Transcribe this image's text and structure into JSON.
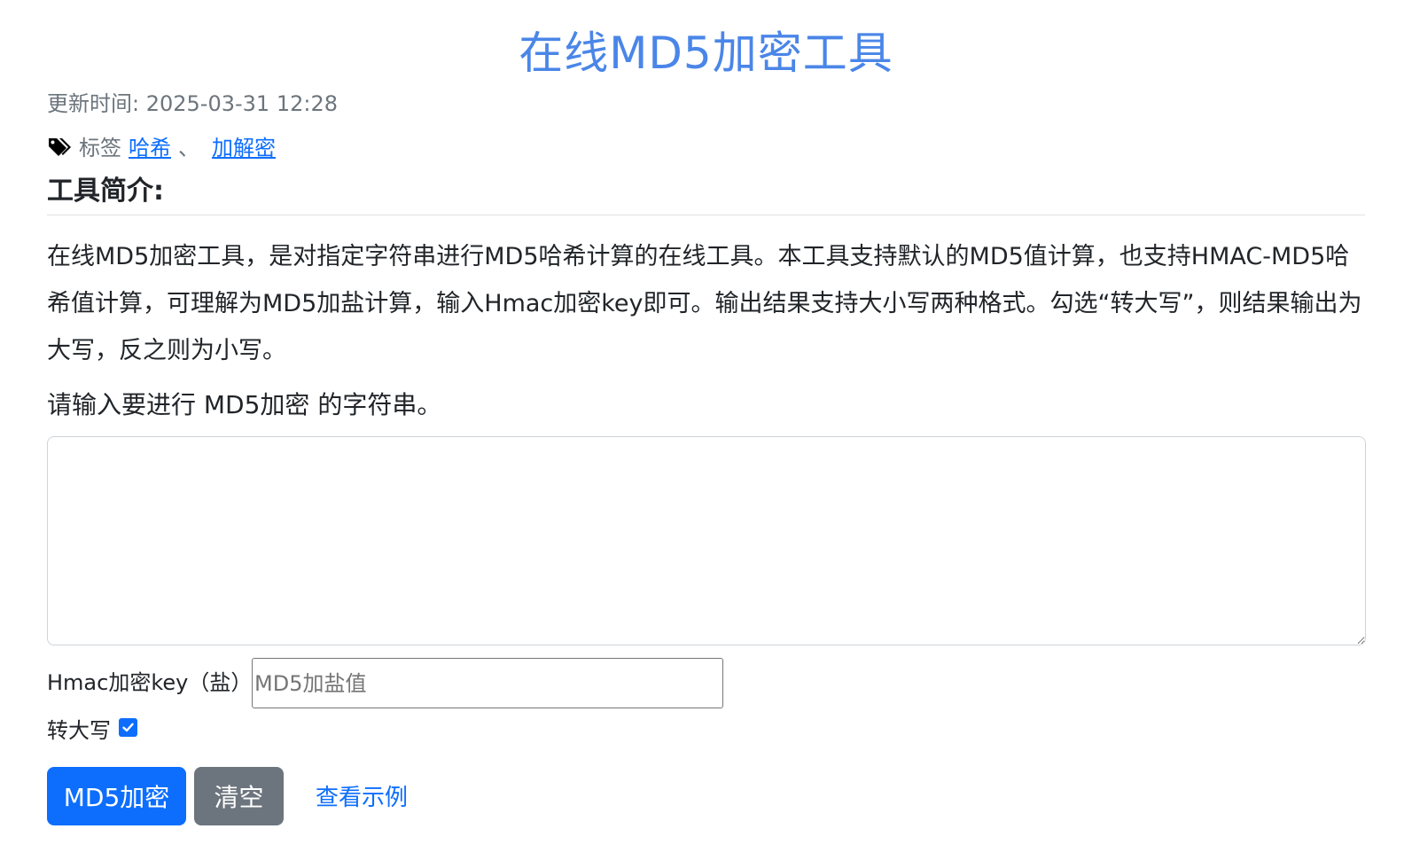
{
  "page": {
    "title": "在线MD5加密工具",
    "updated": "更新时间: 2025-03-31 12:28",
    "tags_label": "标签",
    "tags": [
      "哈希",
      "加解密"
    ],
    "tag_separator": "、",
    "section_heading": "工具简介:",
    "intro": "在线MD5加密工具，是对指定字符串进行MD5哈希计算的在线工具。本工具支持默认的MD5值计算，也支持HMAC-MD5哈希值计算，可理解为MD5加盐计算，输入Hmac加密key即可。输出结果支持大小写两种格式。勾选“转大写”，则结果输出为大写，反之则为小写。",
    "prompt": "请输入要进行 MD5加密 的字符串。"
  },
  "form": {
    "input_value": "",
    "hmac_label": "Hmac加密key（盐）",
    "hmac_value": "",
    "hmac_placeholder": "MD5加盐值",
    "uppercase_label": "转大写",
    "uppercase_checked": true
  },
  "actions": {
    "encrypt_label": "MD5加密",
    "clear_label": "清空",
    "example_label": "查看示例"
  },
  "colors": {
    "title": "#4a86e8",
    "primary": "#0d6efd",
    "secondary": "#6c757d",
    "link": "#0d6efd"
  },
  "icons": {
    "tag": "tags-icon",
    "check": "check-icon"
  }
}
